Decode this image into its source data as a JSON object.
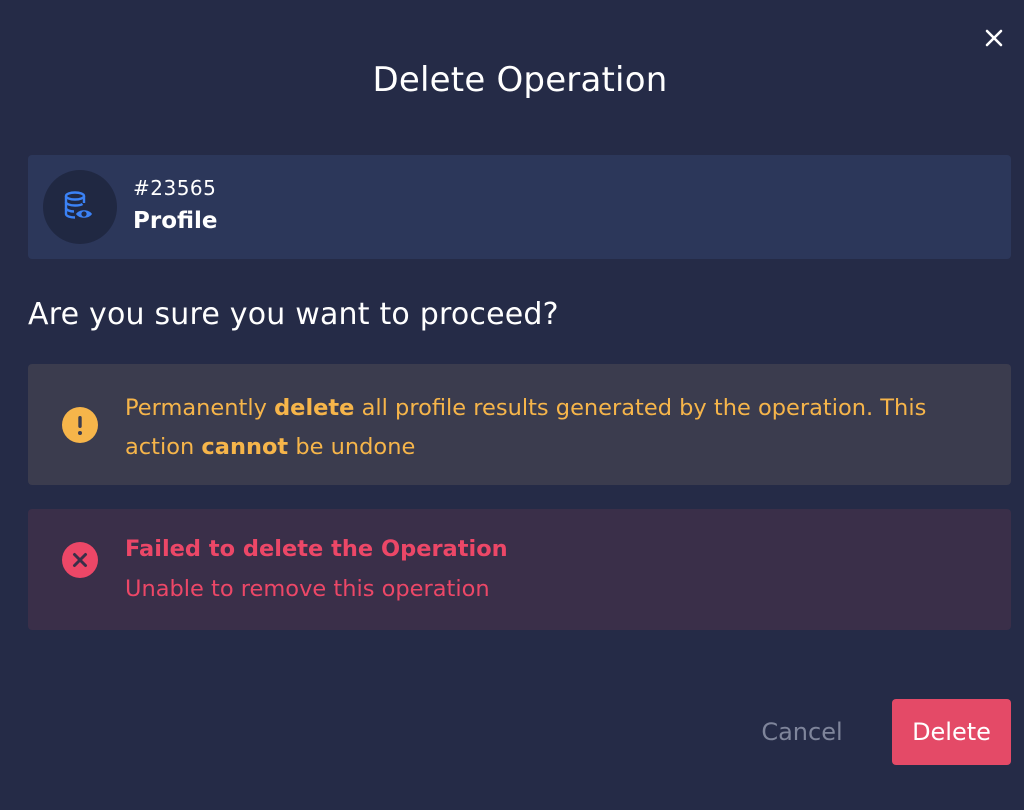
{
  "dialog": {
    "title": "Delete Operation",
    "close_icon": "close-icon"
  },
  "operation": {
    "id": "#23565",
    "name": "Profile",
    "icon": "database-eye-icon",
    "accent_color": "#3b82f6"
  },
  "question": "Are you sure you want to proceed?",
  "warning": {
    "icon": "exclamation-circle-icon",
    "color": "#f6b54a",
    "part1": "Permanently ",
    "bold1": "delete",
    "part2": " all profile results generated by the operation. This action ",
    "bold2": "cannot",
    "part3": " be undone"
  },
  "error": {
    "icon": "x-circle-icon",
    "color": "#ec4767",
    "title": "Failed to delete the Operation",
    "message": "Unable to remove this operation"
  },
  "actions": {
    "cancel_label": "Cancel",
    "delete_label": "Delete",
    "delete_color": "#e44a67"
  }
}
